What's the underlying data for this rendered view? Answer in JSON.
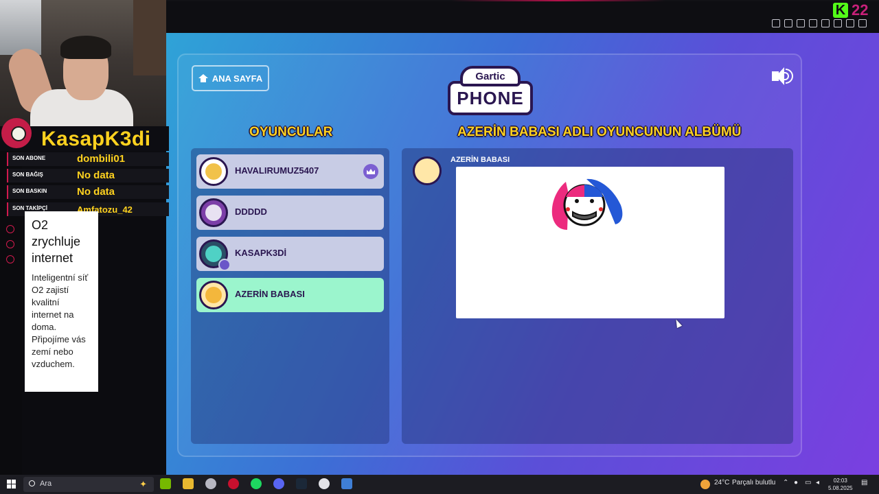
{
  "browser": {
    "kick_count": "22"
  },
  "stream_overlay": {
    "channel_name": "KasapK3di",
    "stats": [
      {
        "label": "SON ABONE",
        "value": "dombili01"
      },
      {
        "label": "SON BAĞIŞ",
        "value": "No data"
      },
      {
        "label": "SON BASKIN",
        "value": "No data"
      },
      {
        "label": "SON TAKİPÇİ",
        "value": "Amfatozu_42"
      }
    ]
  },
  "ad": {
    "title": "O2 zrychluje internet",
    "body": "Inteligentní síť O2 zajistí kvalitní internet na doma. Připojíme vás zemí nebo vzduchem."
  },
  "game": {
    "home_button_label": "ANA SAYFA",
    "logo_top": "Gartic",
    "logo_bottom": "PHONE",
    "players_heading": "OYUNCULAR",
    "album_heading": "AZERİN BABASI ADLI OYUNCUNUN ALBÜMÜ",
    "players": [
      {
        "name": "HAVALIRUMUZ5407",
        "host": true,
        "active": false
      },
      {
        "name": "DDDDD",
        "host": false,
        "active": false
      },
      {
        "name": "KASAPK3Dİ",
        "host": false,
        "active": false
      },
      {
        "name": "AZERİN BABASI",
        "host": false,
        "active": true
      }
    ],
    "album_author": "AZERİN BABASI"
  },
  "taskbar": {
    "search_placeholder": "Ara",
    "weather_temp": "24°C",
    "weather_desc": "Parçalı bulutlu",
    "time": "02:03",
    "date": "5.08.2025"
  },
  "colors": {
    "accent_yellow": "#ffd21f",
    "active_player": "#9bf5cd",
    "player_row": "#c8cce5",
    "kick_green": "#53fc18"
  }
}
